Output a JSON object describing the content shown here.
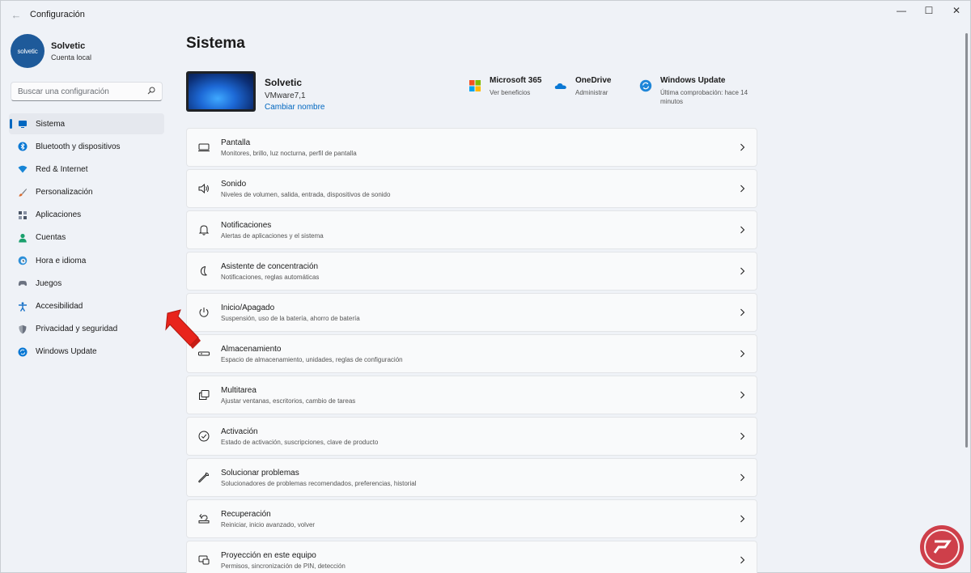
{
  "window": {
    "title": "Configuración",
    "controls": [
      "—",
      "☐",
      "✕"
    ]
  },
  "profile": {
    "avatar_text": "solvetic",
    "name": "Solvetic",
    "account": "Cuenta local"
  },
  "search": {
    "placeholder": "Buscar una configuración"
  },
  "sidebar": {
    "items": [
      {
        "label": "Sistema",
        "icon": "system-icon",
        "color": "#0067c0",
        "active": true
      },
      {
        "label": "Bluetooth y dispositivos",
        "icon": "bluetooth-icon",
        "color": "#0a78d4",
        "active": false
      },
      {
        "label": "Red & Internet",
        "icon": "wifi-icon",
        "color": "#1785d6",
        "active": false
      },
      {
        "label": "Personalización",
        "icon": "brush-icon",
        "color": "#d96a2e",
        "active": false
      },
      {
        "label": "Aplicaciones",
        "icon": "apps-icon",
        "color": "#4a5566",
        "active": false
      },
      {
        "label": "Cuentas",
        "icon": "accounts-icon",
        "color": "#1aa06d",
        "active": false
      },
      {
        "label": "Hora e idioma",
        "icon": "globe-clock-icon",
        "color": "#2d8fd8",
        "active": false
      },
      {
        "label": "Juegos",
        "icon": "gamepad-icon",
        "color": "#6b7280",
        "active": false
      },
      {
        "label": "Accesibilidad",
        "icon": "accessibility-icon",
        "color": "#1a73c8",
        "active": false
      },
      {
        "label": "Privacidad y seguridad",
        "icon": "shield-icon",
        "color": "#6b7280",
        "active": false
      },
      {
        "label": "Windows Update",
        "icon": "update-icon",
        "color": "#0a78d4",
        "active": false
      }
    ]
  },
  "main": {
    "title": "Sistema",
    "device": {
      "name": "Solvetic",
      "model": "VMware7,1",
      "rename_link": "Cambiar nombre"
    },
    "quick_links": [
      {
        "title": "Microsoft 365",
        "sub": "Ver beneficios",
        "icon": "microsoft-365-icon"
      },
      {
        "title": "OneDrive",
        "sub": "Administrar",
        "icon": "onedrive-icon"
      },
      {
        "title": "Windows Update",
        "sub": "Última comprobación: hace 14 minutos",
        "icon": "windows-update-icon"
      }
    ],
    "rows": [
      {
        "title": "Pantalla",
        "sub": "Monitores, brillo, luz nocturna, perfil de pantalla",
        "icon": "display-icon"
      },
      {
        "title": "Sonido",
        "sub": "Niveles de volumen, salida, entrada, dispositivos de sonido",
        "icon": "speaker-icon"
      },
      {
        "title": "Notificaciones",
        "sub": "Alertas de aplicaciones y el sistema",
        "icon": "bell-icon"
      },
      {
        "title": "Asistente de concentración",
        "sub": "Notificaciones, reglas automáticas",
        "icon": "moon-icon"
      },
      {
        "title": "Inicio/Apagado",
        "sub": "Suspensión, uso de la batería, ahorro de batería",
        "icon": "power-icon"
      },
      {
        "title": "Almacenamiento",
        "sub": "Espacio de almacenamiento, unidades, reglas de configuración",
        "icon": "storage-icon"
      },
      {
        "title": "Multitarea",
        "sub": "Ajustar ventanas, escritorios, cambio de tareas",
        "icon": "multitask-icon"
      },
      {
        "title": "Activación",
        "sub": "Estado de activación, suscripciones, clave de producto",
        "icon": "check-circle-icon"
      },
      {
        "title": "Solucionar problemas",
        "sub": "Solucionadores de problemas recomendados, preferencias, historial",
        "icon": "wrench-icon"
      },
      {
        "title": "Recuperación",
        "sub": "Reiniciar, inicio avanzado, volver",
        "icon": "recovery-icon"
      },
      {
        "title": "Proyección en este equipo",
        "sub": "Permisos, sincronización de PIN, detección",
        "icon": "projection-icon"
      }
    ]
  },
  "colors": {
    "accent": "#0067c0",
    "arrow": "#e8241c",
    "watermark": "#c8202b"
  }
}
